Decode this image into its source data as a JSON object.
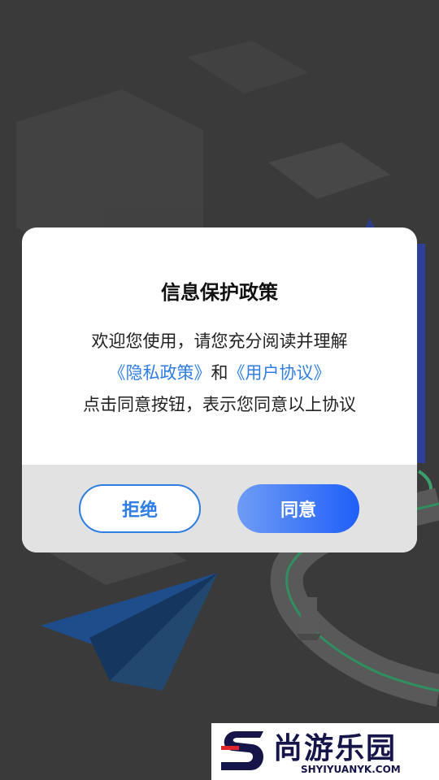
{
  "dialog": {
    "title": "信息保护政策",
    "line1": "欢迎您使用，请您充分阅读并理解",
    "privacy_link": "《隐私政策》",
    "conjunction": "和",
    "user_agreement_link": "《用户协议》",
    "line3": "点击同意按钮，表示您同意以上协议",
    "reject_label": "拒绝",
    "agree_label": "同意"
  },
  "watermark": {
    "title": "尚游乐园",
    "subtitle": "SHYIYUANYK.COM"
  },
  "colors": {
    "link": "#2f7ee3",
    "agree_gradient_start": "#6f9cf5",
    "agree_gradient_end": "#1f5ff8",
    "button_area": "#e2e2e2",
    "watermark_red": "#e0262b",
    "watermark_navy": "#15154a"
  }
}
